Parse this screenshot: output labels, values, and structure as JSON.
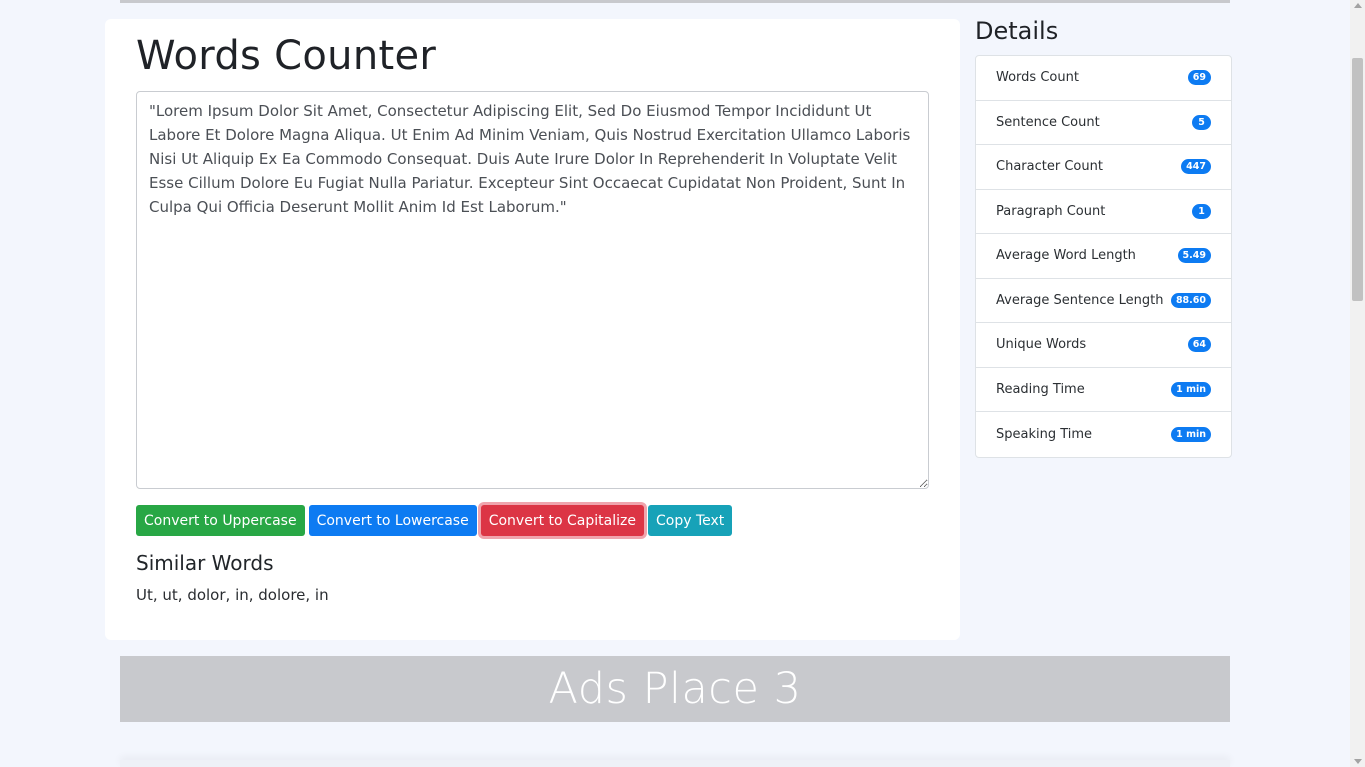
{
  "title": "Words Counter",
  "textarea": {
    "value": "\"Lorem Ipsum Dolor Sit Amet, Consectetur Adipiscing Elit, Sed Do Eiusmod Tempor Incididunt Ut Labore Et Dolore Magna Aliqua. Ut Enim Ad Minim Veniam, Quis Nostrud Exercitation Ullamco Laboris Nisi Ut Aliquip Ex Ea Commodo Consequat. Duis Aute Irure Dolor In Reprehenderit In Voluptate Velit Esse Cillum Dolore Eu Fugiat Nulla Pariatur. Excepteur Sint Occaecat Cupidatat Non Proident, Sunt In Culpa Qui Officia Deserunt Mollit Anim Id Est Laborum.\""
  },
  "buttons": {
    "uppercase": "Convert to Uppercase",
    "lowercase": "Convert to Lowercase",
    "capitalize": "Convert to Capitalize",
    "copy": "Copy Text"
  },
  "similar": {
    "heading": "Similar Words",
    "words": "Ut, ut, dolor, in, dolore, in"
  },
  "details": {
    "heading": "Details",
    "items": [
      {
        "label": "Words Count",
        "value": "69"
      },
      {
        "label": "Sentence Count",
        "value": "5"
      },
      {
        "label": "Character Count",
        "value": "447"
      },
      {
        "label": "Paragraph Count",
        "value": "1"
      },
      {
        "label": "Average Word Length",
        "value": "5.49"
      },
      {
        "label": "Average Sentence Length",
        "value": "88.60"
      },
      {
        "label": "Unique Words",
        "value": "64"
      },
      {
        "label": "Reading Time",
        "value": "1 min"
      },
      {
        "label": "Speaking Time",
        "value": "1 min"
      }
    ]
  },
  "ads": {
    "label": "Ads Place 3"
  },
  "colors": {
    "success": "#28a745",
    "primary": "#0d7bf2",
    "danger": "#dc3545",
    "info": "#17a2b8",
    "ads_bg": "#c8c9cd",
    "page_bg": "#f3f6fd"
  }
}
